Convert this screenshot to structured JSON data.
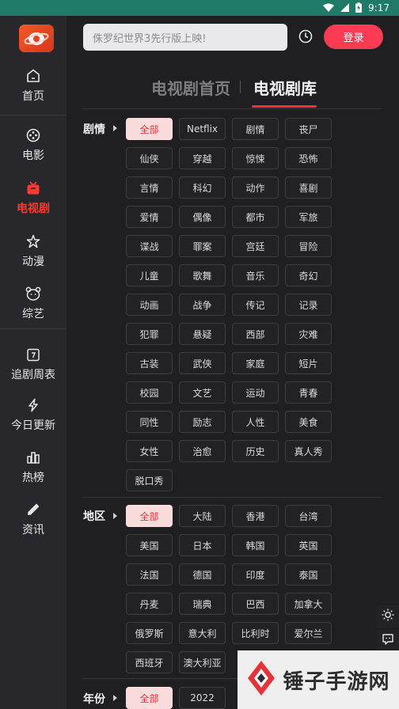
{
  "status_bar": {
    "time": "9:17"
  },
  "sidebar": {
    "items": [
      {
        "label": "首页",
        "icon": "home-icon"
      },
      {
        "label": "电影",
        "icon": "film-reel-icon"
      },
      {
        "label": "电视剧",
        "icon": "tv-icon",
        "active": true
      },
      {
        "label": "动漫",
        "icon": "star-icon"
      },
      {
        "label": "综艺",
        "icon": "bear-icon"
      },
      {
        "label": "追剧周表",
        "icon": "calendar-icon"
      },
      {
        "label": "今日更新",
        "icon": "lightning-icon"
      },
      {
        "label": "热榜",
        "icon": "bar-chart-icon"
      },
      {
        "label": "资讯",
        "icon": "pencil-icon"
      }
    ]
  },
  "header": {
    "search_placeholder": "侏罗纪世界3先行版上映!",
    "login_label": "登录"
  },
  "tabs": [
    {
      "label": "电视剧首页"
    },
    {
      "label": "电视剧库",
      "active": true
    }
  ],
  "filters": {
    "genre": {
      "label": "剧情",
      "options": [
        "全部",
        "Netflix",
        "剧情",
        "丧尸",
        "仙侠",
        "穿越",
        "惊悚",
        "恐怖",
        "言情",
        "科幻",
        "动作",
        "喜剧",
        "爱情",
        "偶像",
        "都市",
        "军旅",
        "谍战",
        "罪案",
        "宫廷",
        "冒险",
        "儿童",
        "歌舞",
        "音乐",
        "奇幻",
        "动画",
        "战争",
        "传记",
        "记录",
        "犯罪",
        "悬疑",
        "西部",
        "灾难",
        "古装",
        "武侠",
        "家庭",
        "短片",
        "校园",
        "文艺",
        "运动",
        "青春",
        "同性",
        "励志",
        "人性",
        "美食",
        "女性",
        "治愈",
        "历史",
        "真人秀",
        "脱口秀"
      ],
      "selected": "全部"
    },
    "region": {
      "label": "地区",
      "options": [
        "全部",
        "大陆",
        "香港",
        "台湾",
        "美国",
        "日本",
        "韩国",
        "英国",
        "法国",
        "德国",
        "印度",
        "泰国",
        "丹麦",
        "瑞典",
        "巴西",
        "加拿大",
        "俄罗斯",
        "意大利",
        "比利时",
        "爱尔兰",
        "西班牙",
        "澳大利亚"
      ],
      "selected": "全部"
    },
    "year": {
      "label": "年份",
      "options": [
        "全部",
        "2022"
      ],
      "selected": "全部"
    }
  },
  "watermark": {
    "text": "锤子手游网"
  },
  "colors": {
    "accent": "#ff3a2e",
    "login": "#ff3a55",
    "status_bar": "#207a68"
  }
}
